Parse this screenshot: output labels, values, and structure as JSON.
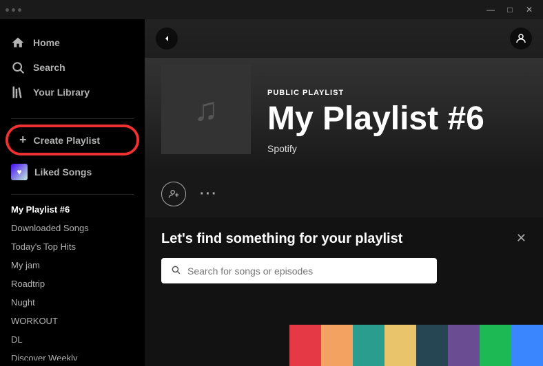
{
  "titlebar": {
    "dots": [
      "dot1",
      "dot2",
      "dot3"
    ],
    "controls": {
      "minimize": "—",
      "maximize": "□",
      "close": "✕"
    }
  },
  "sidebar": {
    "nav_items": [
      {
        "id": "home",
        "label": "Home",
        "icon": "home-icon"
      },
      {
        "id": "search",
        "label": "Search",
        "icon": "search-icon"
      },
      {
        "id": "library",
        "label": "Your Library",
        "icon": "library-icon"
      }
    ],
    "create_playlist_label": "Create Playlist",
    "liked_songs_label": "Liked Songs",
    "playlists": [
      {
        "id": "pl6",
        "label": "My Playlist #6",
        "active": true
      },
      {
        "id": "dl-songs",
        "label": "Downloaded Songs",
        "active": false
      },
      {
        "id": "top-hits",
        "label": "Today's Top Hits",
        "active": false
      },
      {
        "id": "my-jam",
        "label": "My jam",
        "active": false
      },
      {
        "id": "roadtrip",
        "label": "Roadtrip",
        "active": false
      },
      {
        "id": "nught",
        "label": "Nught",
        "active": false
      },
      {
        "id": "workout",
        "label": "WORKOUT",
        "active": false
      },
      {
        "id": "dl",
        "label": "DL",
        "active": false
      },
      {
        "id": "discover",
        "label": "Discover Weekly",
        "active": false
      }
    ]
  },
  "main": {
    "back_button_label": "‹",
    "hero": {
      "type_label": "PUBLIC PLAYLIST",
      "title": "My Playlist #6",
      "subtitle": "Spotify"
    },
    "action_bar": {
      "add_user_label": "➕👤",
      "more_label": "···"
    },
    "find_section": {
      "title": "Let's find something for your playlist",
      "search_placeholder": "Search for songs or episodes",
      "close_label": "✕"
    }
  },
  "colors": {
    "sidebar_bg": "#000000",
    "main_bg": "#121212",
    "hero_bg": "#3a3a3a",
    "accent": "#1db954",
    "text_primary": "#ffffff",
    "text_secondary": "#b3b3b3"
  }
}
